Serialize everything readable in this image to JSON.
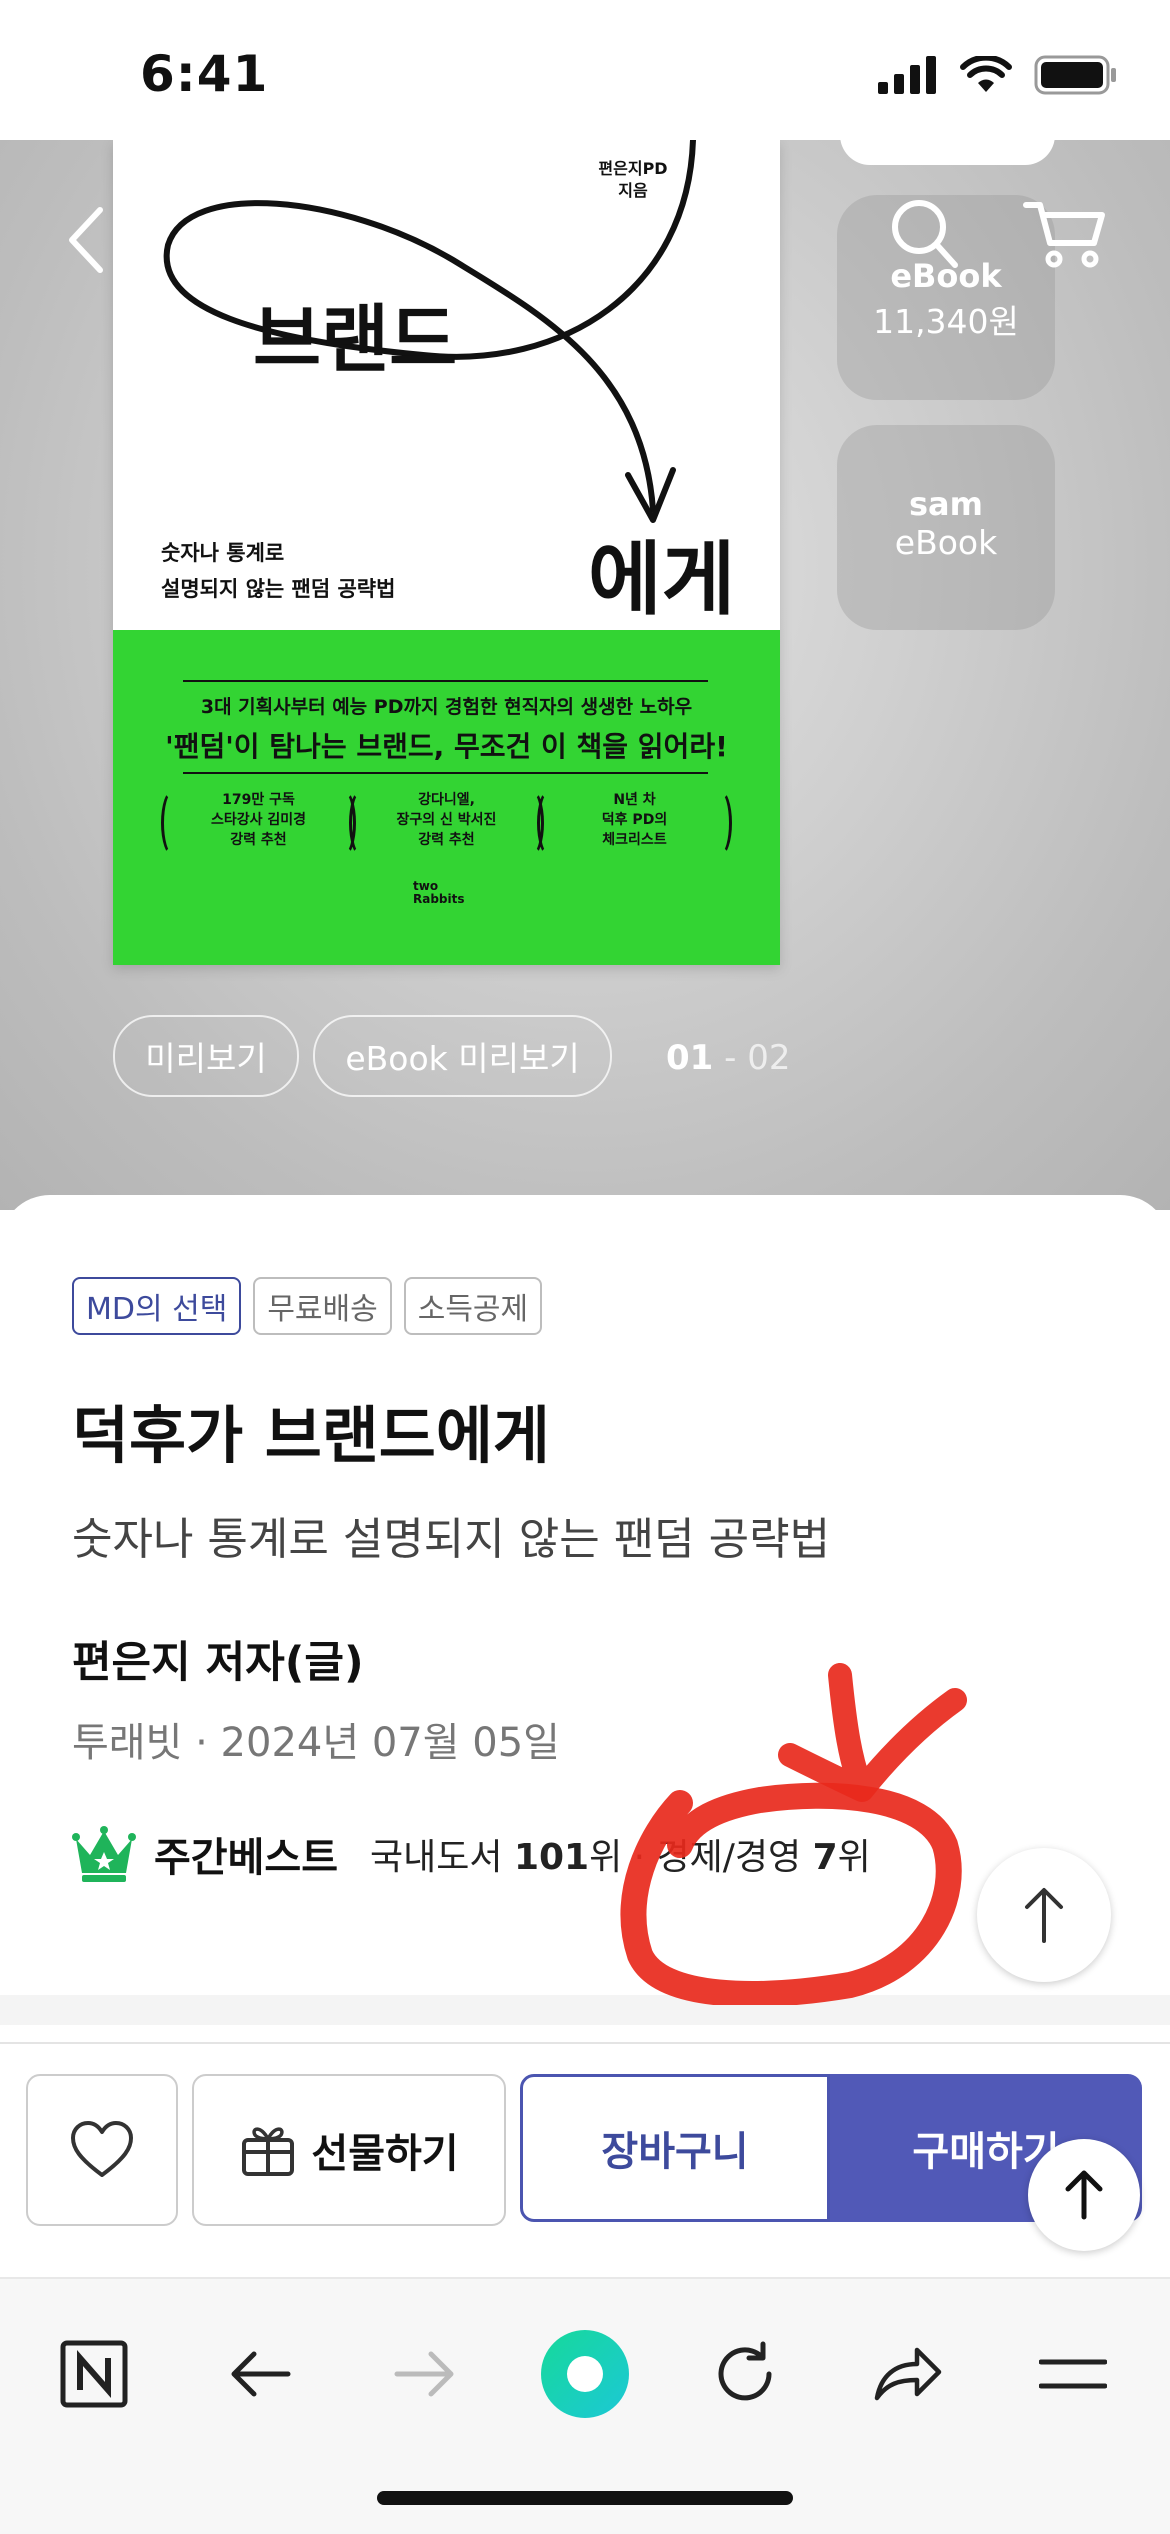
{
  "status_bar": {
    "time": "6:41"
  },
  "cover": {
    "author": "편은지PD\n지음",
    "title_part1": "브랜드",
    "subtitle_line1": "숫자나 통계로",
    "subtitle_line2": "설명되지 않는 팬덤 공략법",
    "title_part2": "에게",
    "copy1": "3대 기획사부터 예능 PD까지 경험한 현직자의 생생한 노하우",
    "copy2": "'팬덤'이 탐나는 브랜드, 무조건 이 책을 읽어라!",
    "recommendations": [
      "179만 구독\n스타강사 김미경\n강력 추천",
      "강다니엘,\n장구의 신 박서진\n강력 추천",
      "N년 차\n덕후 PD의\n체크리스트"
    ],
    "publisher_logo": "two\nRabbits"
  },
  "side_buttons": [
    {
      "line1": "eBook",
      "line2": "11,340원"
    },
    {
      "line1": "sam",
      "line2": "eBook"
    }
  ],
  "preview": {
    "buttons": [
      "미리보기",
      "eBook 미리보기"
    ],
    "page_current": "01",
    "page_rest": " - 02"
  },
  "book": {
    "badges": [
      "MD의 선택",
      "무료배송",
      "소득공제"
    ],
    "title": "덕후가 브랜드에게",
    "subtitle": "숫자나 통계로 설명되지 않는 팬덤 공략법",
    "author": "편은지 저자(글)",
    "publisher_date": "투래빗 · 2024년 07월 05일",
    "bestseller": {
      "label": "주간베스트",
      "domestic_prefix": "국내도서 ",
      "domestic_rank": "101",
      "domestic_suffix": "위 · 경제/경영 ",
      "category_rank": "7",
      "category_suffix": "위"
    }
  },
  "actions": {
    "gift": "선물하기",
    "cart": "장바구니",
    "buy": "구매하기"
  },
  "colors": {
    "accent": "#5159b7",
    "cover_green": "#33d433",
    "annotation_red": "#e8291c",
    "crown_green": "#1fb45a",
    "home_button_green": "#16d99a"
  }
}
